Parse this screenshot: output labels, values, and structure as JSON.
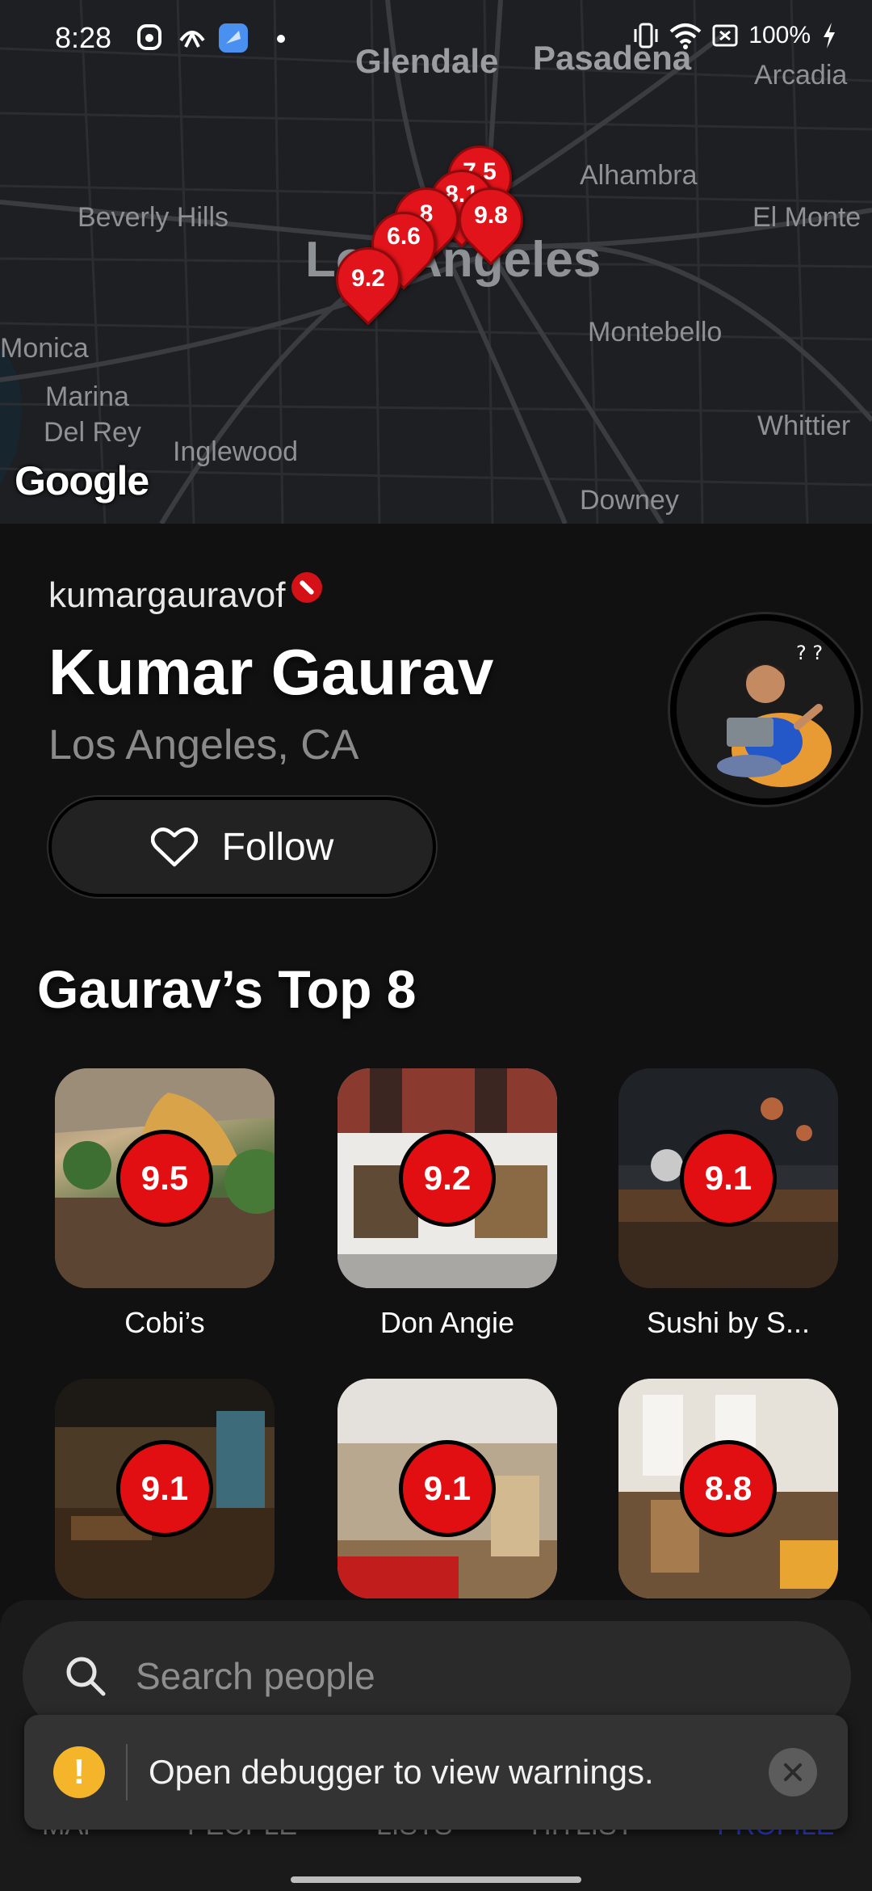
{
  "status_bar": {
    "time": "8:28",
    "battery": "100%",
    "icons": [
      "threads-icon",
      "airdrop-icon",
      "app-icon",
      "dot-icon",
      "vibrate-icon",
      "wifi-icon",
      "battery-saver-icon",
      "charging-icon"
    ]
  },
  "map": {
    "labels": [
      "Glendale",
      "Pasadena",
      "Arcadia",
      "Alhambra",
      "Beverly Hills",
      "El Monte",
      "Los Angeles",
      "Montebello",
      "Monica",
      "Marina",
      "Del Rey",
      "Inglewood",
      "Whittier",
      "Downey"
    ],
    "provider": "Google",
    "pins": [
      "7.5",
      "8.1",
      "9.8",
      "8",
      "6.6",
      "9.2"
    ],
    "pin_color": "#e0141a"
  },
  "profile": {
    "username": "kumargauravof",
    "name": "Kumar Gaurav",
    "location": "Los Angeles, CA",
    "follow_label": "Follow"
  },
  "top8": {
    "title": "Gaurav’s Top 8",
    "items": [
      {
        "score": "9.5",
        "name": "Cobi’s"
      },
      {
        "score": "9.2",
        "name": "Don Angie"
      },
      {
        "score": "9.1",
        "name": "Sushi by S..."
      },
      {
        "score": "9.1",
        "name": ""
      },
      {
        "score": "9.1",
        "name": ""
      },
      {
        "score": "8.8",
        "name": ""
      }
    ],
    "badge_color": "#e10e12"
  },
  "tabs": {
    "items": [
      "MAP",
      "PEOPLE",
      "LISTS",
      "HITLIST",
      "PROFILE"
    ],
    "active": "PROFILE"
  },
  "search": {
    "placeholder": "Search people"
  },
  "toast": {
    "message": "Open debugger to view warnings.",
    "warning_symbol": "!"
  }
}
